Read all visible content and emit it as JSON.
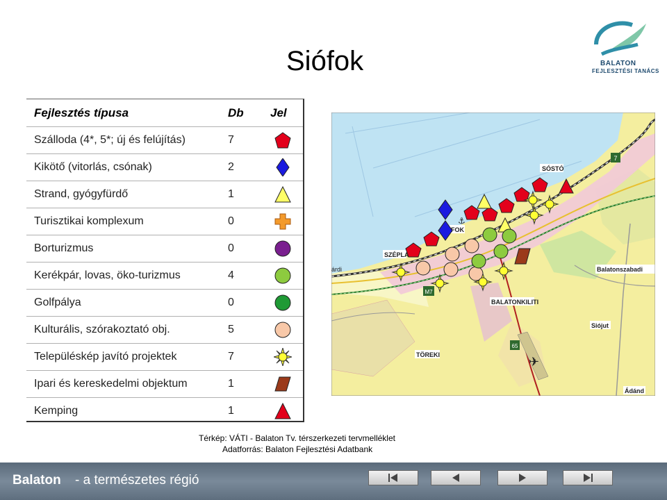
{
  "title": "Siófok",
  "logo": {
    "line1": "BALATON",
    "line2": "FEJLESZTÉSI TANÁCS"
  },
  "table": {
    "headers": {
      "type": "Fejlesztés típusa",
      "count": "Db",
      "symbol": "Jel"
    },
    "rows": [
      {
        "label": "Szálloda (4*, 5*; új és felújítás)",
        "count": "7",
        "icon": "red-pentagon-icon",
        "color": "#e3001b"
      },
      {
        "label": "Kikötő (vitorlás, csónak)",
        "count": "2",
        "icon": "blue-diamond-icon",
        "color": "#1a1adf"
      },
      {
        "label": "Strand, gyógyfürdő",
        "count": "1",
        "icon": "yellow-triangle-icon",
        "color": "#ffff66"
      },
      {
        "label": "Turisztikai komplexum",
        "count": "0",
        "icon": "orange-cross-icon",
        "color": "#f39a2b"
      },
      {
        "label": "Borturizmus",
        "count": "0",
        "icon": "purple-circle-icon",
        "color": "#7a1f8f"
      },
      {
        "label": "Kerékpár, lovas, öko-turizmus",
        "count": "4",
        "icon": "light-green-circle-icon",
        "color": "#8dcb3f"
      },
      {
        "label": "Golfpálya",
        "count": "0",
        "icon": "green-circle-icon",
        "color": "#1f9a35"
      },
      {
        "label": "Kulturális, szórakoztató obj.",
        "count": "5",
        "icon": "peach-circle-icon",
        "color": "#f8c8a8"
      },
      {
        "label": "Településkép javító projektek",
        "count": "7",
        "icon": "sun-icon",
        "color": "#ffff33"
      },
      {
        "label": "Ipari és kereskedelmi objektum",
        "count": "1",
        "icon": "brown-parallelogram-icon",
        "color": "#9b3a1a"
      },
      {
        "label": "Kemping",
        "count": "1",
        "icon": "red-triangle-icon",
        "color": "#e3001b"
      }
    ]
  },
  "map": {
    "places": [
      "SÓSTÓ",
      "FOK",
      "SZÉPLAK",
      "árdi",
      "Balatonszabadi",
      "BALATONKILITI",
      "Siójut",
      "TÖREKI",
      "Ádánd"
    ],
    "roads": [
      "7",
      "M7",
      "65"
    ]
  },
  "credits": {
    "line1": "Térkép: VÁTI - Balaton Tv. térszerkezeti tervmelléklet",
    "line2": "Adatforrás: Balaton Fejlesztési Adatbank"
  },
  "footer": {
    "brand": "Balaton",
    "tagline": "- a természetes régió"
  },
  "nav": {
    "first": "first-icon",
    "prev": "prev-icon",
    "next": "next-icon",
    "last": "last-icon"
  }
}
